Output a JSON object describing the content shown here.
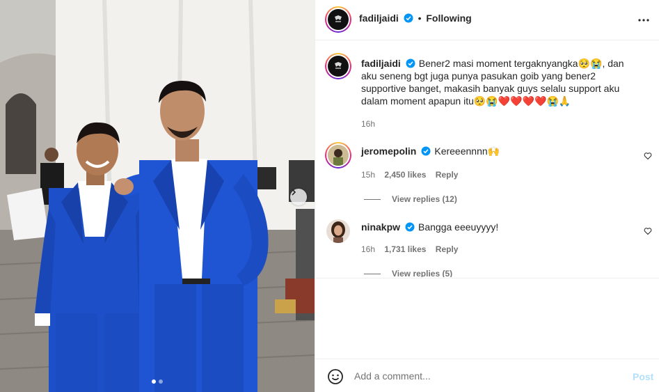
{
  "header": {
    "username": "fadiljaidi",
    "separator": "•",
    "follow_status": "Following"
  },
  "caption": {
    "username": "fadiljaidi",
    "text": "Bener2 masi moment tergaknyangka🥺😭, dan aku seneng bgt juga punya pasukan goib yang bener2 supportive banget, makasih banyak guys selalu support aku dalam moment apapun itu🥺😭❤️❤️❤️❤️😭🙏",
    "time": "16h"
  },
  "comments": [
    {
      "username": "jeromepolin",
      "text": "Kereeennnn🙌",
      "time": "15h",
      "likes": "2,450 likes",
      "reply_label": "Reply",
      "view_replies": "View replies (12)"
    },
    {
      "username": "ninakpw",
      "text": "Bangga eeeuyyyy!",
      "time": "16h",
      "likes": "1,731 likes",
      "reply_label": "Reply",
      "view_replies": "View replies (5)"
    }
  ],
  "comment_box": {
    "placeholder": "Add a comment...",
    "post_label": "Post"
  },
  "carousel": {
    "current": 1,
    "total": 2
  },
  "colors": {
    "verified": "#0095f6",
    "post_disabled": "#b2dffc",
    "suit_blue": "#1d4fc9"
  }
}
